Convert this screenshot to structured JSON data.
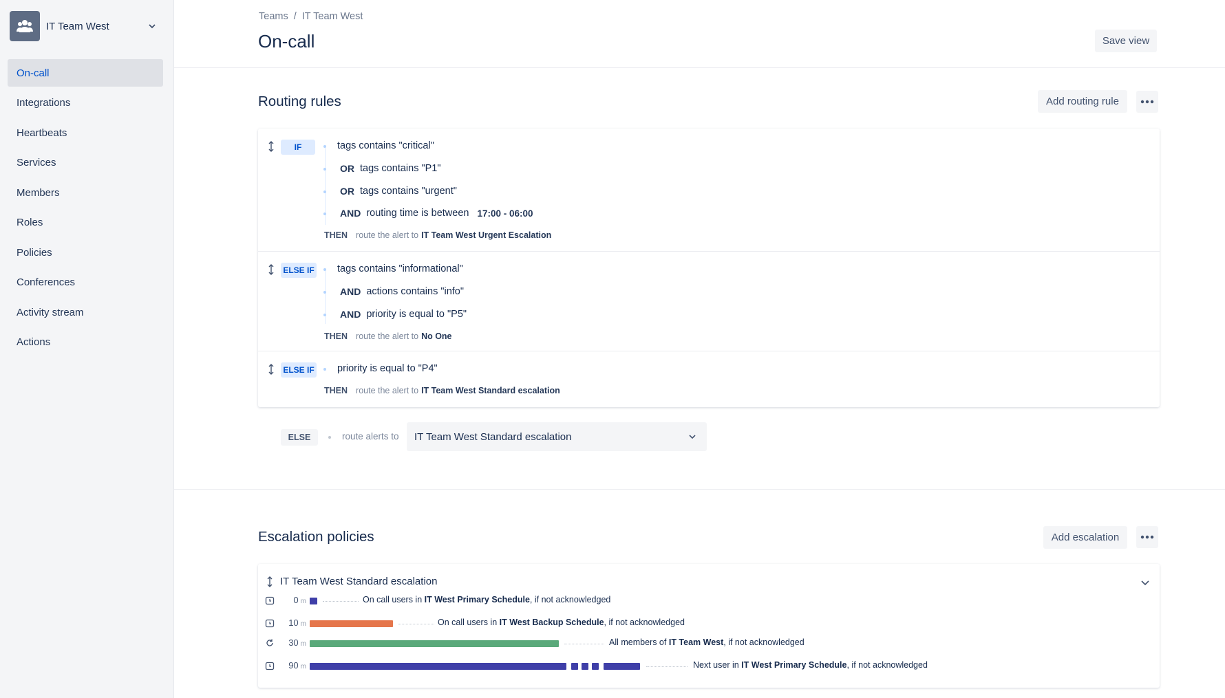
{
  "team": {
    "name": "IT Team West"
  },
  "nav": {
    "items": [
      {
        "label": "On-call"
      },
      {
        "label": "Integrations"
      },
      {
        "label": "Heartbeats"
      },
      {
        "label": "Services"
      },
      {
        "label": "Members"
      },
      {
        "label": "Roles"
      },
      {
        "label": "Policies"
      },
      {
        "label": "Conferences"
      },
      {
        "label": "Activity stream"
      },
      {
        "label": "Actions"
      }
    ],
    "active": "On-call"
  },
  "breadcrumb": {
    "root": "Teams",
    "sep": "/",
    "current": "IT Team West"
  },
  "page": {
    "title": "On-call",
    "save_view": "Save view"
  },
  "routing": {
    "title": "Routing rules",
    "add_label": "Add routing rule",
    "rules": [
      {
        "kind": "IF",
        "conditions": [
          {
            "op": "",
            "text": "tags contains \"critical\"",
            "value": ""
          },
          {
            "op": "OR",
            "text": "tags contains \"P1\"",
            "value": ""
          },
          {
            "op": "OR",
            "text": "tags contains \"urgent\"",
            "value": ""
          },
          {
            "op": "AND",
            "text": "routing time is between",
            "value": "17:00 - 06:00"
          }
        ],
        "then_key": "THEN",
        "then_text": "route the alert to",
        "then_target": "IT Team West Urgent Escalation"
      },
      {
        "kind": "ELSE IF",
        "conditions": [
          {
            "op": "",
            "text": "tags contains \"informational\"",
            "value": ""
          },
          {
            "op": "AND",
            "text": "actions contains \"info\"",
            "value": ""
          },
          {
            "op": "AND",
            "text": "priority is equal to \"P5\"",
            "value": ""
          }
        ],
        "then_key": "THEN",
        "then_text": "route the alert to",
        "then_target": "No One"
      },
      {
        "kind": "ELSE IF",
        "conditions": [
          {
            "op": "",
            "text": "priority is equal to \"P4\"",
            "value": ""
          }
        ],
        "then_key": "THEN",
        "then_text": "route the alert to",
        "then_target": "IT Team West Standard escalation"
      }
    ],
    "else": {
      "label": "ELSE",
      "text": "route alerts to",
      "selected": "IT Team West Standard escalation"
    }
  },
  "escalation": {
    "title": "Escalation policies",
    "add_label": "Add escalation",
    "policy_name": "IT Team West Standard escalation",
    "steps": [
      {
        "time": "0",
        "unit": "m",
        "icon": "clock-icon",
        "color": "#3f3fa8",
        "pre": "On call users in ",
        "target": "IT West Primary Schedule",
        "post": ", if not acknowledged"
      },
      {
        "time": "10",
        "unit": "m",
        "icon": "clock-icon",
        "color": "#e5764b",
        "pre": "On call users in ",
        "target": "IT West Backup Schedule",
        "post": ", if not acknowledged"
      },
      {
        "time": "30",
        "unit": "m",
        "icon": "repeat-icon",
        "color": "#5aa97a",
        "pre": "All members of ",
        "target": "IT Team West",
        "post": ", if not acknowledged"
      },
      {
        "time": "90",
        "unit": "m",
        "icon": "clock-icon",
        "color": "#3f3fa8",
        "pre": "Next user in ",
        "target": "IT West Primary Schedule",
        "post": ", if not acknowledged"
      }
    ]
  },
  "colors": {
    "accent": "#0052cc",
    "pill_bg": "#deebff"
  }
}
